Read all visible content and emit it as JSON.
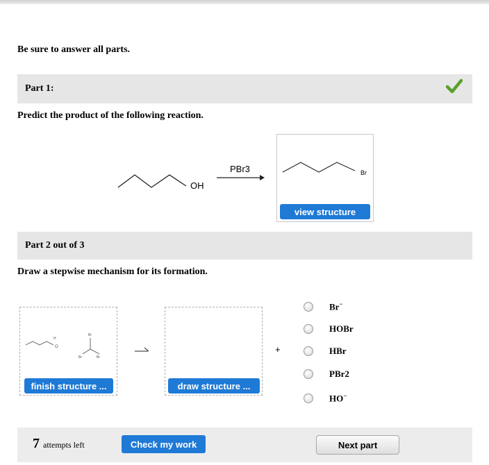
{
  "header": {
    "instruction": "Be sure to answer all parts."
  },
  "part1": {
    "label": "Part 1:",
    "status_icon": "green-checkmark",
    "question": "Predict the product of the following reaction.",
    "reactant_label": "OH",
    "reagent": "PBr3",
    "product_label": "Br",
    "view_button": "view structure"
  },
  "part2": {
    "label": "Part 2 out of 3",
    "question": "Draw a stepwise mechanism for its formation.",
    "sketch_label_br": "Br",
    "finish_button": "finish structure ...",
    "draw_button": "draw structure ...",
    "plus": "+",
    "options": [
      "Br",
      "HOBr",
      "HBr",
      "PBr2",
      "HO"
    ]
  },
  "footer": {
    "attempts_count": "7",
    "attempts_text": "attempts left",
    "check_button": "Check my work",
    "next_button": "Next part"
  },
  "colors": {
    "accent_blue": "#1f7ad6",
    "check_green": "#5aa02c",
    "part_bar_gray": "#e6e6e6"
  }
}
